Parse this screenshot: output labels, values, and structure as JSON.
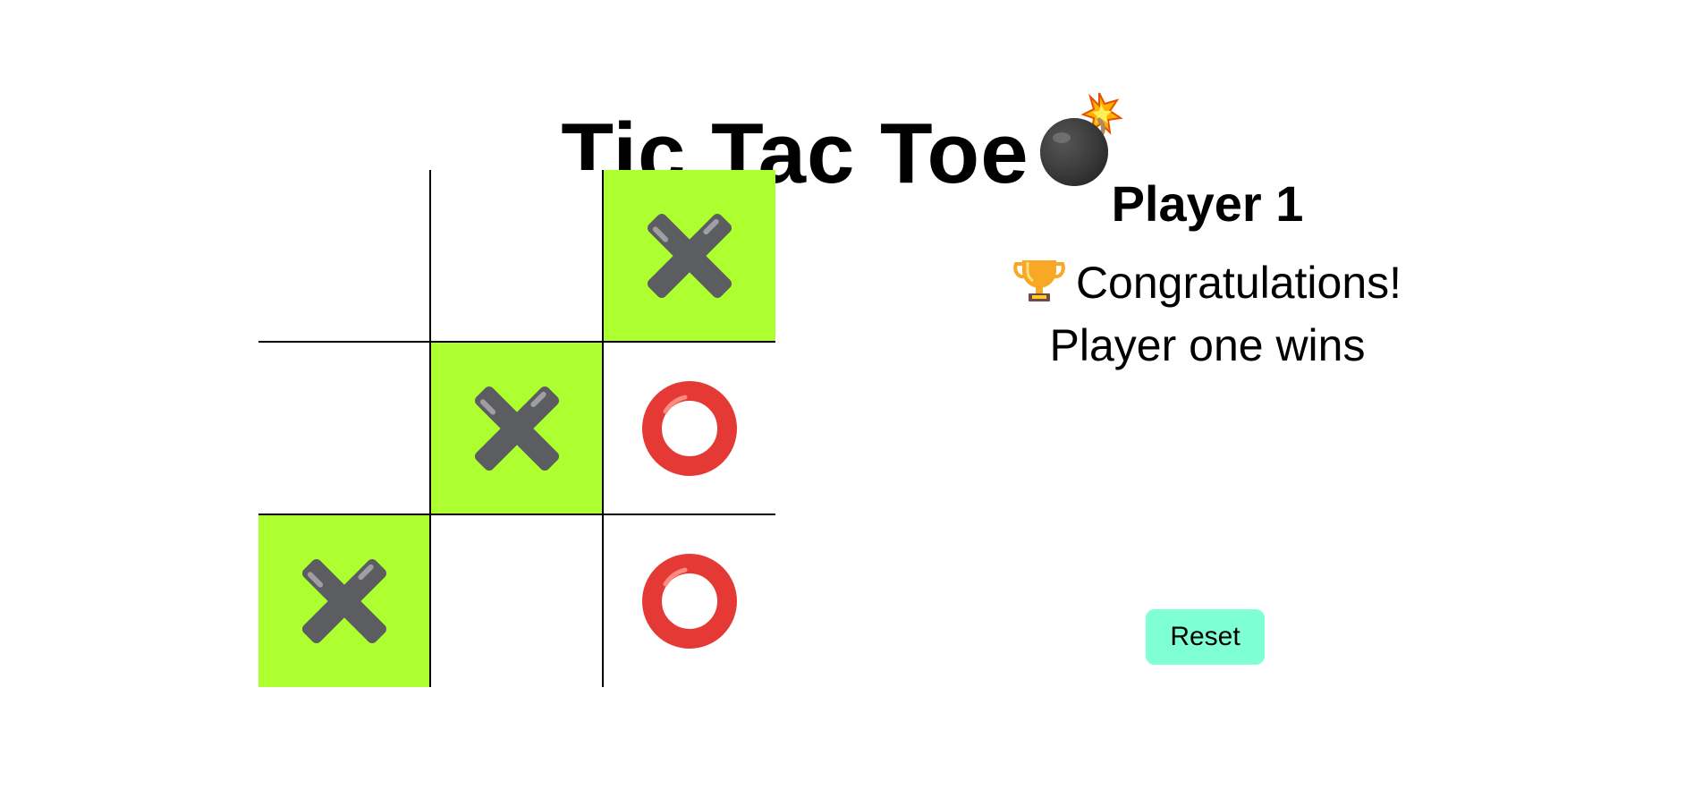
{
  "header": {
    "title": "Tic Tac Toe",
    "title_icon": "bomb-icon"
  },
  "board": {
    "cells": [
      {
        "mark": "",
        "win": false
      },
      {
        "mark": "",
        "win": false
      },
      {
        "mark": "X",
        "win": true
      },
      {
        "mark": "",
        "win": false
      },
      {
        "mark": "X",
        "win": true
      },
      {
        "mark": "O",
        "win": false
      },
      {
        "mark": "X",
        "win": true
      },
      {
        "mark": "",
        "win": false
      },
      {
        "mark": "O",
        "win": false
      }
    ],
    "win_color": "#adff2f",
    "x_color": "#5b5d60",
    "o_color": "#e53935"
  },
  "status": {
    "player": "Player 1",
    "message_line1": "Congratulations!",
    "message_line2": "Player one wins",
    "message_icon": "trophy-icon"
  },
  "controls": {
    "reset_label": "Reset",
    "reset_color": "#7fffd4"
  }
}
